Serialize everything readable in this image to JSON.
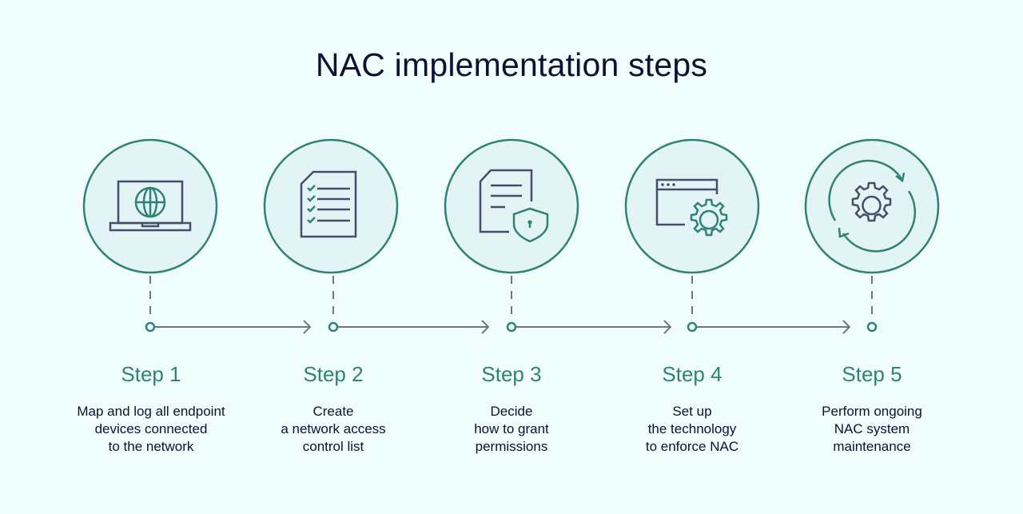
{
  "title": "NAC implementation steps",
  "colors": {
    "background": "#effdfd",
    "circle_fill": "#e3f4f4",
    "accent": "#2f8277",
    "icon_dark": "#454e6a",
    "connector": "#6f7688",
    "text": "#0d1131"
  },
  "steps": [
    {
      "label": "Step 1",
      "icon": "laptop-globe-icon",
      "desc": [
        "Map and log all endpoint",
        "devices connected",
        "to the network"
      ]
    },
    {
      "label": "Step 2",
      "icon": "checklist-document-icon",
      "desc": [
        "Create",
        "a network access",
        "control list"
      ]
    },
    {
      "label": "Step 3",
      "icon": "document-shield-lock-icon",
      "desc": [
        "Decide",
        "how to grant",
        "permissions"
      ]
    },
    {
      "label": "Step 4",
      "icon": "browser-gear-icon",
      "desc": [
        "Set up",
        "the technology",
        "to enforce NAC"
      ]
    },
    {
      "label": "Step 5",
      "icon": "gear-refresh-icon",
      "desc": [
        "Perform ongoing",
        "NAC system",
        "maintenance"
      ]
    }
  ]
}
